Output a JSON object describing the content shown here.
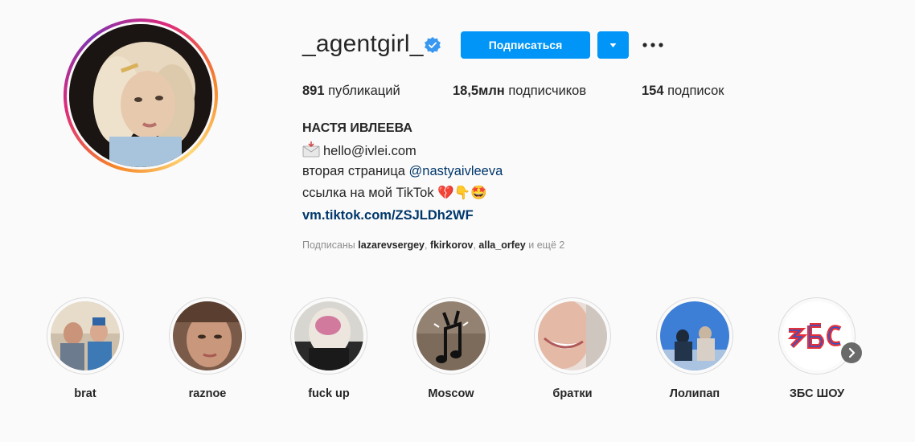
{
  "profile": {
    "username": "_agentgirl_",
    "subscribe_label": "Подписаться",
    "stats": {
      "posts_count": "891",
      "posts_label": "публикаций",
      "followers_count": "18,5млн",
      "followers_label": "подписчиков",
      "following_count": "154",
      "following_label": "подписок"
    },
    "full_name": "НАСТЯ ИВЛЕЕВА",
    "bio": {
      "email_line": "hello@ivlei.com",
      "second_page_prefix": "вторая страница",
      "second_page_mention": "@nastyaivleeva",
      "tiktok_line": "ссылка на мой TikTok",
      "tiktok_emojis": "💔👇🤩",
      "link": "vm.tiktok.com/ZSJLDh2WF"
    },
    "followed_by": {
      "prefix": "Подписаны",
      "names": [
        "lazarevsergey",
        "fkirkorov",
        "alla_orfey"
      ],
      "suffix": "и ещё 2"
    }
  },
  "highlights": [
    {
      "label": "brat",
      "icon": "two-people-costume-photo"
    },
    {
      "label": "raznoe",
      "icon": "face-closeup-photo"
    },
    {
      "label": "fuck up",
      "icon": "blurred-face-photo"
    },
    {
      "label": "Moscow",
      "icon": "music-note-rock-hand"
    },
    {
      "label": "братки",
      "icon": "laughing-mouth-photo"
    },
    {
      "label": "Лолипап",
      "icon": "people-sky-photo"
    },
    {
      "label": "ЗБС ШОУ",
      "icon": "zbs-logo"
    }
  ],
  "colors": {
    "accent": "#0095f6",
    "link": "#00376b",
    "muted": "#8e8e8e",
    "text": "#262626",
    "background": "#fafafa"
  }
}
